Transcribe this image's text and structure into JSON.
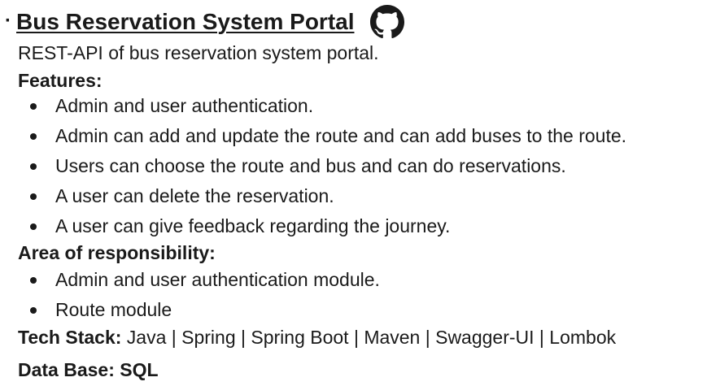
{
  "project": {
    "bullet": "·",
    "title": "Bus Reservation System Portal",
    "repo_icon": "github-icon",
    "description": "REST-API of bus reservation system portal."
  },
  "features": {
    "heading": "Features:",
    "items": [
      "Admin and user authentication.",
      "Admin can add and update the route and can add buses to the route.",
      "Users can choose the route and bus and can do reservations.",
      "A user can delete the reservation.",
      "A user can give feedback regarding the journey."
    ]
  },
  "responsibility": {
    "heading": "Area of responsibility:",
    "items": [
      "Admin and user authentication module.",
      "Route module"
    ]
  },
  "tech_stack": {
    "label": "Tech Stack:",
    "value": " Java | Spring | Spring Boot | Maven | Swagger-UI | Lombok"
  },
  "database": {
    "label": "Data Base: SQL"
  },
  "colors": {
    "text": "#1a1a1a",
    "background": "#ffffff"
  }
}
